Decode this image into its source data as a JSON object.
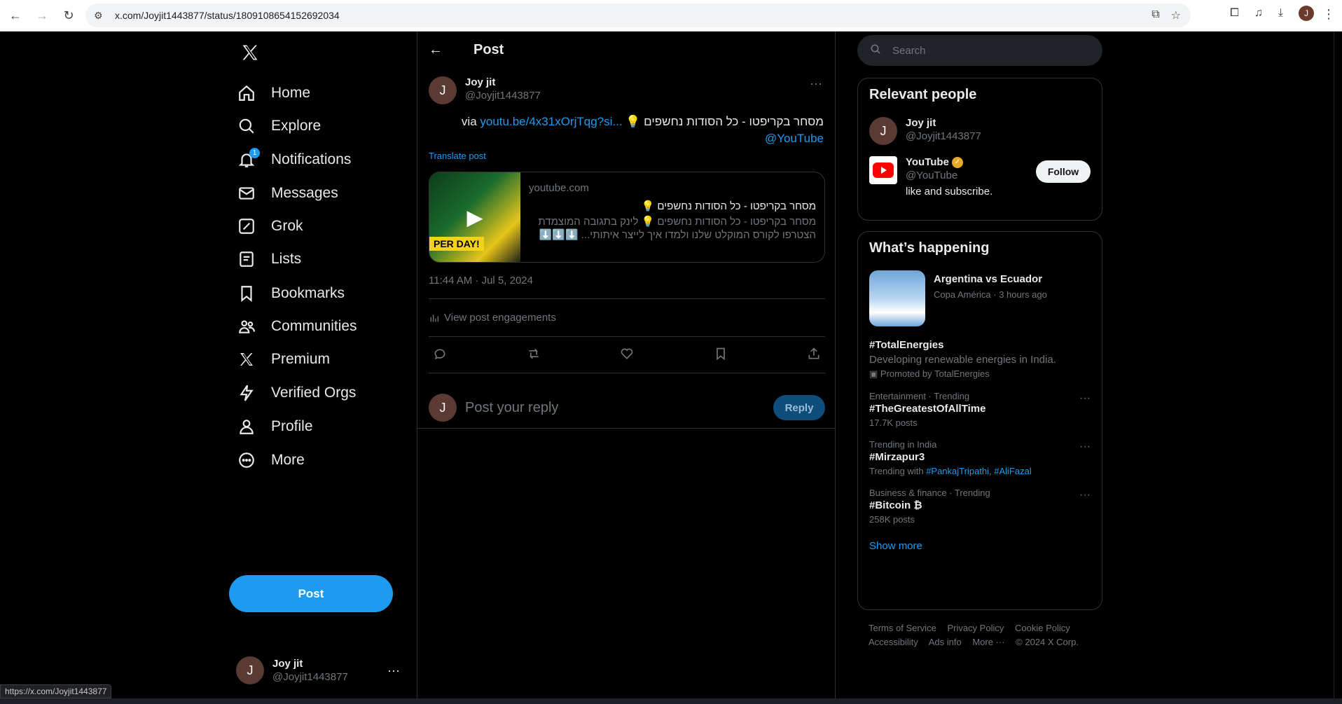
{
  "browser": {
    "url": "x.com/Joyjit1443877/status/1809108654152692034",
    "status_url": "https://x.com/Joyjit1443877"
  },
  "nav": {
    "items": [
      {
        "label": "Home",
        "icon": "home-icon"
      },
      {
        "label": "Explore",
        "icon": "search-icon"
      },
      {
        "label": "Notifications",
        "icon": "bell-icon",
        "badge": "1"
      },
      {
        "label": "Messages",
        "icon": "mail-icon"
      },
      {
        "label": "Grok",
        "icon": "grok-icon"
      },
      {
        "label": "Lists",
        "icon": "list-icon"
      },
      {
        "label": "Bookmarks",
        "icon": "bookmark-icon"
      },
      {
        "label": "Communities",
        "icon": "people-icon"
      },
      {
        "label": "Premium",
        "icon": "x-icon"
      },
      {
        "label": "Verified Orgs",
        "icon": "lightning-icon"
      },
      {
        "label": "Profile",
        "icon": "person-icon"
      },
      {
        "label": "More",
        "icon": "more-circle-icon"
      }
    ],
    "post_label": "Post"
  },
  "account": {
    "initial": "J",
    "name": "Joy jit",
    "handle": "@Joyjit1443877"
  },
  "main": {
    "header_title": "Post",
    "post": {
      "author_initial": "J",
      "author_name": "Joy jit",
      "author_handle": "@Joyjit1443877",
      "text_main": "מסחר בקריפטו - כל הסודות נחשפים 💡",
      "link_text": "youtu.be/4x31xOrjTqg?si...",
      "via": "via",
      "mention": "@YouTube",
      "translate_label": "Translate post",
      "card": {
        "domain": "youtube.com",
        "title": "מסחר בקריפטו - כל הסודות נחשפים 💡",
        "desc_line1": "מסחר בקריפטו - כל הסודות נחשפים 💡 לינק בתגובה המוצמדת",
        "desc_line2": "הצטרפו לקורס המוקלט שלנו ולמדו איך לייצר איתותי... ⬇️⬇️⬇️",
        "thumb_text": "PER DAY!"
      },
      "timestamp": "11:44 AM · Jul 5, 2024",
      "engagements_label": "View post engagements"
    },
    "reply": {
      "initial": "J",
      "placeholder": "Post your reply",
      "button": "Reply"
    }
  },
  "right": {
    "search_placeholder": "Search",
    "relevant": {
      "title": "Relevant people",
      "people": [
        {
          "initial": "J",
          "name": "Joy jit",
          "handle": "@Joyjit1443877"
        },
        {
          "name": "YouTube",
          "handle": "@YouTube",
          "bio": "like and subscribe.",
          "follow": "Follow"
        }
      ]
    },
    "happening": {
      "title": "What’s happening",
      "feature": {
        "name": "Argentina vs Ecuador",
        "meta": "Copa América · 3 hours ago"
      },
      "promoted": {
        "name": "#TotalEnergies",
        "desc": "Developing renewable energies in India.",
        "meta": "Promoted by TotalEnergies"
      },
      "trends": [
        {
          "meta": "Entertainment · Trending",
          "name": "#TheGreatestOfAllTime",
          "sub": "17.7K posts"
        },
        {
          "meta": "Trending in India",
          "name": "#Mirzapur3",
          "sub_prefix": "Trending with",
          "sub_links": "#PankajTripathi, #AliFazal"
        },
        {
          "meta": "Business & finance · Trending",
          "name": "#Bitcoin ₿",
          "sub": "258K posts"
        }
      ],
      "show_more": "Show more"
    },
    "footer": {
      "line1": [
        "Terms of Service",
        "Privacy Policy",
        "Cookie Policy"
      ],
      "line2": [
        "Accessibility",
        "Ads info",
        "More ···",
        "© 2024 X Corp."
      ]
    }
  },
  "colors": {
    "accent": "#1d9bf0",
    "bg": "#000000",
    "border": "#2f3336",
    "muted": "#71767b"
  }
}
